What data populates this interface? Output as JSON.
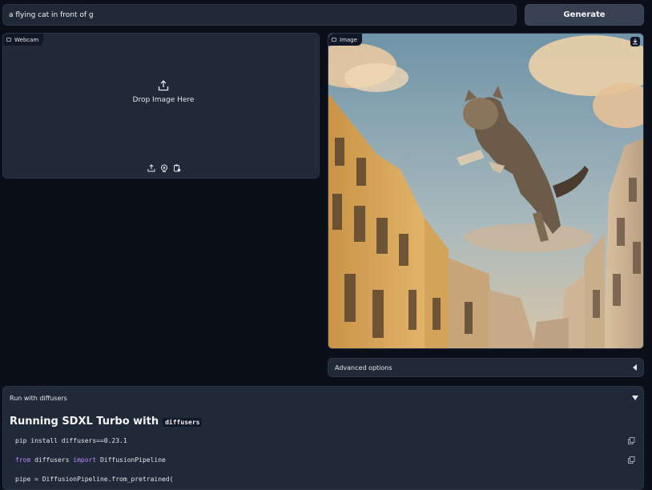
{
  "prompt": {
    "value": "a flying cat in front of g",
    "placeholder": ""
  },
  "generate_button": {
    "label": "Generate"
  },
  "webcam_panel": {
    "label": "Webcam",
    "drop_text": "Drop Image Here"
  },
  "image_panel": {
    "label": "Image"
  },
  "advanced": {
    "label": "Advanced options"
  },
  "diffusers": {
    "header": "Run with diffusers",
    "heading": "Running SDXL Turbo with",
    "heading_code": "diffusers",
    "code1": "pip install diffusers==0.23.1",
    "code2": {
      "kw_from": "from",
      "module": " diffusers ",
      "kw_import": "import",
      "name": " DiffusionPipeline"
    },
    "code3": "pipe = DiffusionPipeline.from_pretrained("
  },
  "colors": {
    "background": "#0b0f19",
    "panel": "#1f2937",
    "keyword": "#c084fc"
  }
}
